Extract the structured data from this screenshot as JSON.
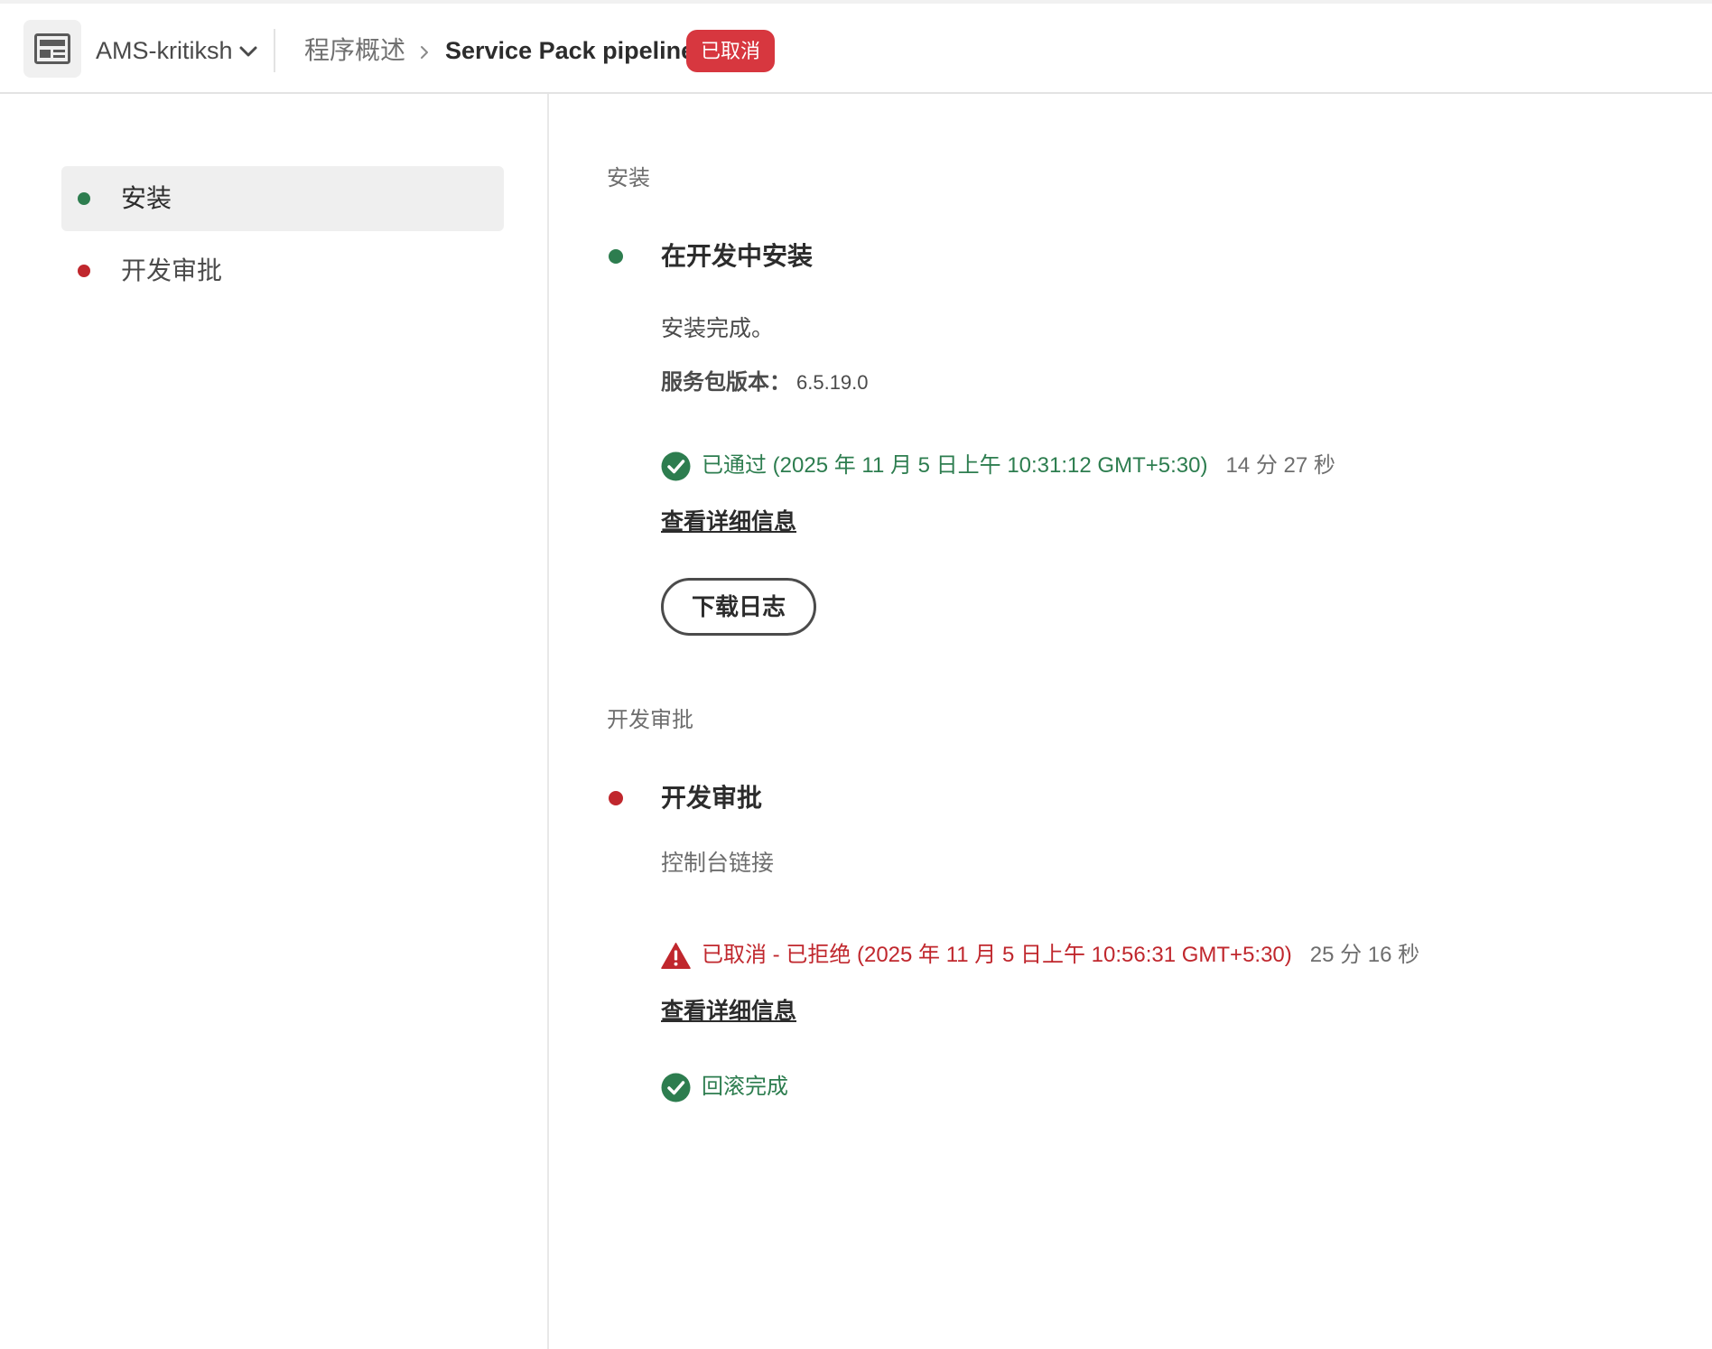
{
  "header": {
    "program_name": "AMS-kritiksh",
    "breadcrumb_overview": "程序概述",
    "pipeline_name": "Service Pack pipeline",
    "status_badge": "已取消"
  },
  "sidebar": {
    "items": [
      {
        "label": "安装",
        "status_color": "#2d7d4f",
        "active": true
      },
      {
        "label": "开发审批",
        "status_color": "#c0272d",
        "active": false
      }
    ]
  },
  "main": {
    "install": {
      "section_heading": "安装",
      "step_title": "在开发中安装",
      "status_color": "#2d7d4f",
      "description": "安装完成。",
      "version_label": "服务包版本：",
      "version_value": "6.5.19.0",
      "result_text": "已通过 (2025 年 11 月 5 日上午 10:31:12  GMT+5:30)",
      "result_duration": "14 分 27 秒",
      "details_link": "查看详细信息",
      "download_button": "下载日志"
    },
    "approval": {
      "section_heading": "开发审批",
      "step_title": "开发审批",
      "status_color": "#c0272d",
      "description": "控制台链接",
      "result_text": "已取消 - 已拒绝 (2025 年 11 月 5 日上午 10:56:31  GMT+5:30)",
      "result_duration": "25 分 16 秒",
      "details_link": "查看详细信息",
      "rollback_text": "回滚完成"
    }
  },
  "colors": {
    "success": "#2d7d4f",
    "error": "#c0272d",
    "badge": "#d7373f"
  }
}
